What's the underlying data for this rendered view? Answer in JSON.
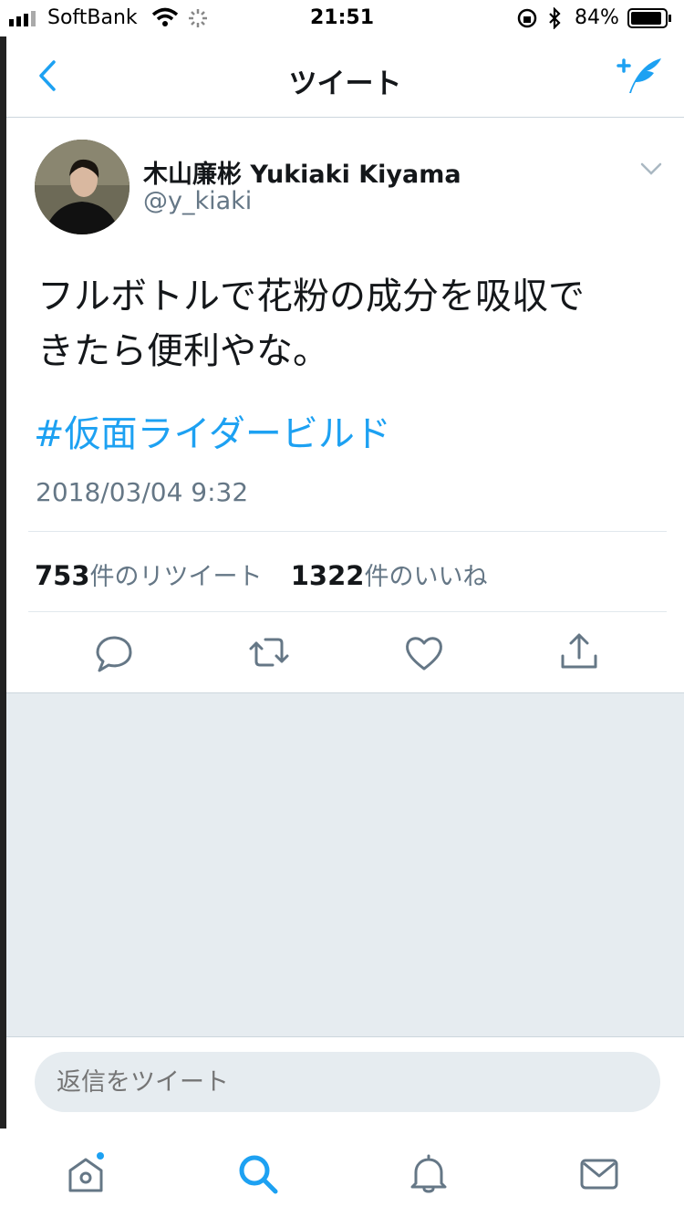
{
  "status_bar": {
    "carrier": "SoftBank",
    "time": "21:51",
    "battery": "84%"
  },
  "nav": {
    "title": "ツイート"
  },
  "tweet": {
    "author_name": "木山廉彬 Yukiaki Kiyama",
    "author_handle": "@y_kiaki",
    "text_line1": "フルボトルで花粉の成分を吸収で",
    "text_line2": "きたら便利やな。",
    "hashtag": "#仮面ライダービルド",
    "date": "2018/03/04 9:32",
    "retweet_count": "753",
    "retweet_label": "件のリツイート",
    "like_count": "1322",
    "like_label": "件のいいね"
  },
  "reply": {
    "placeholder": "返信をツイート"
  },
  "colors": {
    "accent": "#1da1f2",
    "secondary_text": "#657786",
    "background_grey": "#e6ecf0"
  }
}
